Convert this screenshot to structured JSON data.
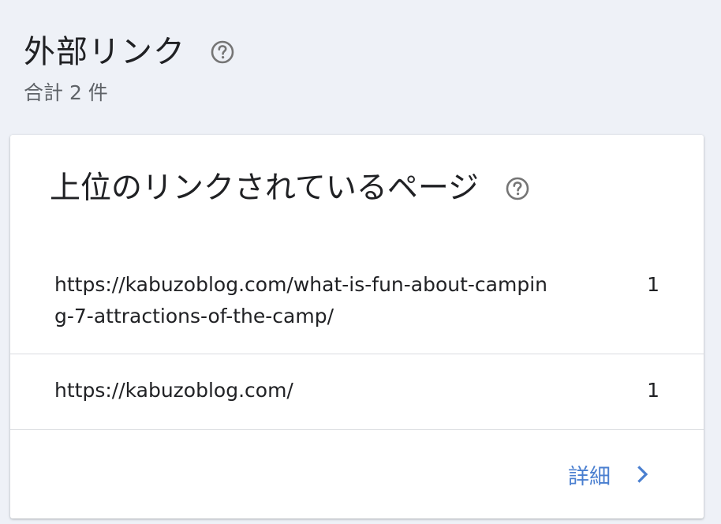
{
  "header": {
    "title": "外部リンク",
    "total": "合計 2 件"
  },
  "card": {
    "title": "上位のリンクされているページ",
    "rows": [
      {
        "url": "https://kabuzoblog.com/what-is-fun-about-camping-7-attractions-of-the-camp/",
        "count": "1"
      },
      {
        "url": "https://kabuzoblog.com/",
        "count": "1"
      }
    ],
    "details_label": "詳細"
  },
  "colors": {
    "background": "#eef1f7",
    "card": "#ffffff",
    "accent": "#4a7fd0",
    "divider": "#dadce0",
    "icon": "#757575"
  },
  "icons": {
    "help": "help-circle-icon",
    "chevron": "chevron-right-icon"
  }
}
